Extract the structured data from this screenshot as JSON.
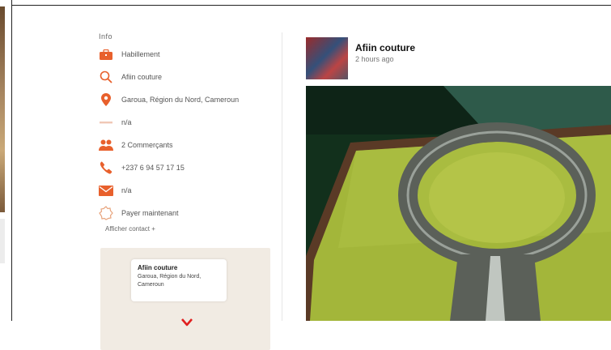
{
  "info": {
    "heading": "Info",
    "rows": [
      {
        "icon": "briefcase-icon",
        "text": "Habillement"
      },
      {
        "icon": "search-icon",
        "text": "Afiin couture"
      },
      {
        "icon": "location-pin-icon",
        "text": "Garoua, Région du Nord, Cameroun"
      },
      {
        "icon": "dash-icon",
        "text": "n/a"
      },
      {
        "icon": "people-icon",
        "text": "2 Commerçants"
      },
      {
        "icon": "phone-icon",
        "text": "+237 6 94 57 17 15"
      },
      {
        "icon": "envelope-icon",
        "text": "n/a"
      },
      {
        "icon": "badge-icon",
        "text": "Payer maintenant"
      }
    ],
    "more_link": "Afficher contact +",
    "map_card": {
      "title": "Afiin couture",
      "address": "Garoua, Région du Nord, Cameroun"
    }
  },
  "post": {
    "author": "Afiin couture",
    "time": "2 hours ago"
  },
  "colors": {
    "accent": "#e8602c"
  }
}
